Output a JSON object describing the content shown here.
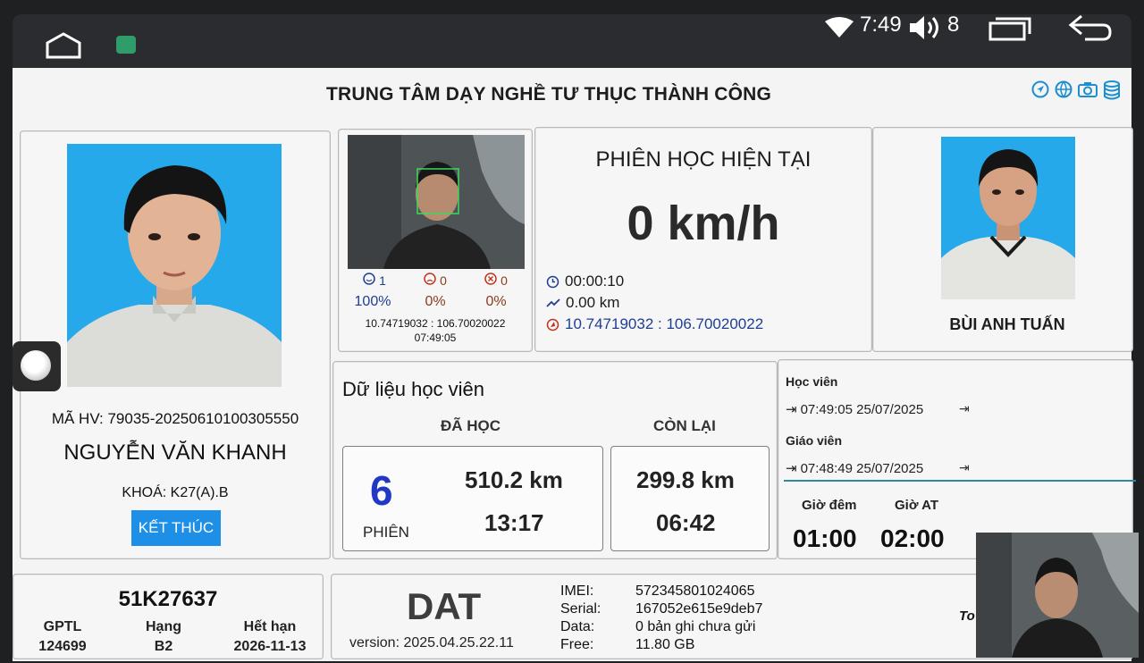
{
  "statusbar": {
    "time": "7:49",
    "volume": "8"
  },
  "app": {
    "title": "TRUNG TÂM DẠY NGHỀ TƯ THỤC THÀNH CÔNG",
    "tool_icons": [
      "navigation-icon",
      "globe-icon",
      "camera-icon",
      "database-icon"
    ]
  },
  "student": {
    "ma_hv": "MÃ HV: 79035-20250610100305550",
    "name": "NGUYỄN VĂN KHANH",
    "course": "KHOÁ: K27(A).B",
    "end_button": "KẾT THÚC"
  },
  "camera": {
    "happy_count": "1",
    "sad_count": "0",
    "absent_count": "0",
    "happy_pct": "100%",
    "sad_pct": "0%",
    "absent_pct": "0%",
    "coords": "10.74719032 : 106.70020022",
    "time": "07:49:05"
  },
  "session": {
    "heading": "PHIÊN HỌC HIỆN TẠI",
    "speed": "0 km/h",
    "duration": "00:00:10",
    "distance": "0.00 km",
    "gps": "10.74719032 : 106.70020022"
  },
  "teacher": {
    "name": "BÙI ANH TUẤN"
  },
  "learning": {
    "title": "Dữ liệu học viên",
    "done_label": "ĐÃ HỌC",
    "remain_label": "CÒN LẠI",
    "sessions": "6",
    "sessions_label": "PHIÊN",
    "done_km": "510.2 km",
    "done_time": "13:17",
    "remain_km": "299.8 km",
    "remain_time": "06:42"
  },
  "logins": {
    "student_label": "Học viên",
    "student_time": "07:49:05 25/07/2025",
    "teacher_label": "Giáo viên",
    "teacher_time": "07:48:49 25/07/2025",
    "night_label": "Giờ đêm",
    "night_value": "01:00",
    "at_label": "Giờ AT",
    "at_value": "02:00"
  },
  "vehicle": {
    "plate": "51K27637",
    "gptl_label": "GPTL",
    "gptl_value": "124699",
    "hang_label": "Hạng",
    "hang_value": "B2",
    "expiry_label": "Hết hạn",
    "expiry_value": "2026-11-13"
  },
  "device": {
    "brand": "DAT",
    "version": "version: 2025.04.25.22.11",
    "imei_label": "IMEI:",
    "imei": "572345801024065",
    "serial_label": "Serial:",
    "serial": "167052e615e9deb7",
    "data_label": "Data:",
    "data": "0 bản ghi chưa gửi",
    "free_label": "Free:",
    "free": "11.80 GB",
    "to_text": "To"
  },
  "colors": {
    "accent_button": "#1e8fe6",
    "session_number": "#2237c4",
    "photo_background": "#25a9ea"
  }
}
